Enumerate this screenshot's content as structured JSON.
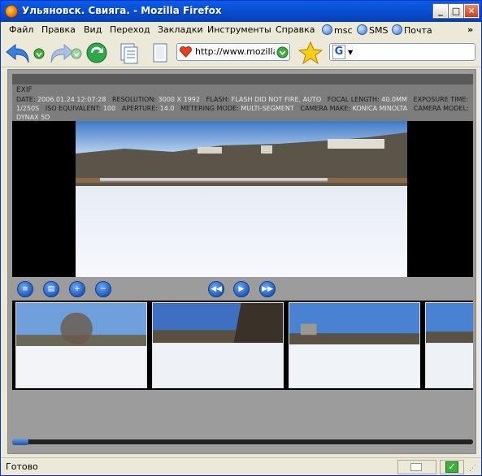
{
  "window": {
    "title": "Ульяновск. Свияга. - Mozilla Firefox"
  },
  "menubar": {
    "items": [
      "Файл",
      "Правка",
      "Вид",
      "Переход",
      "Закладки",
      "Инструменты",
      "Справка"
    ],
    "bookmarks": [
      "msc",
      "SMS",
      "Почта"
    ],
    "overflow": "»"
  },
  "navbar": {
    "url": "http://www.mozilla.o",
    "search_engine": "G"
  },
  "exif": {
    "header": "EXIF",
    "fields": [
      {
        "k": "DATE:",
        "v": "2006.01.24 12:07:28"
      },
      {
        "k": "RESOLUTION:",
        "v": "3000 X 1992"
      },
      {
        "k": "FLASH:",
        "v": "FLASH DID NOT FIRE, AUTO"
      },
      {
        "k": "FOCAL LENGTH:",
        "v": "40.0MM"
      },
      {
        "k": "EXPOSURE TIME:",
        "v": "1/250S"
      },
      {
        "k": "ISO EQUIVALENT:",
        "v": "100"
      },
      {
        "k": "APERTURE:",
        "v": "14.0"
      },
      {
        "k": "METERING MODE:",
        "v": "MULTI-SEGMENT"
      },
      {
        "k": "CAMERA MAKE:",
        "v": "KONICA MINOLTA"
      },
      {
        "k": "CAMERA MODEL:",
        "v": "DYNAX 5D"
      }
    ]
  },
  "status": {
    "text": "Готово"
  },
  "colors": {
    "titlebar": "#0851d4",
    "accent": "#1c57b8",
    "viewer_bg": "#000000"
  }
}
